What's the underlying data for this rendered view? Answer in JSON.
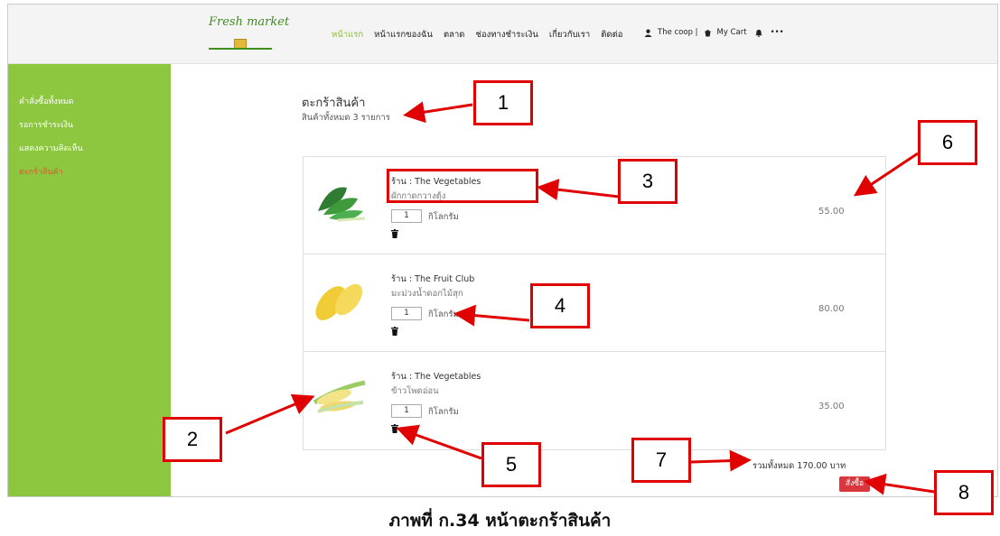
{
  "nav": {
    "logo": "Fresh market",
    "links": [
      "หน้าแรก",
      "หน้าแรกของฉัน",
      "ตลาด",
      "ช่องทางชำระเงิน",
      "เกี่ยวกับเรา",
      "ติดต่อ"
    ],
    "user": "The coop |",
    "cart": "My Cart",
    "more": "•••"
  },
  "sidebar": {
    "items": [
      "คำสั่งซื้อทั้งหมด",
      "รอการชำระเงิน",
      "แสดงความคิดเห็น",
      "ตะกร้าสินค้า"
    ],
    "active_index": 3
  },
  "cart": {
    "title": "ตะกร้าสินค้า",
    "subtitle": "สินค้าทั้งหมด 3 รายการ",
    "items": [
      {
        "shop": "ร้าน : The Vegetables",
        "name": "ผักกาดกวางตุ้ง",
        "qty": "1",
        "unit": "กิโลกรัม",
        "price": "55.00",
        "image": "leafy-greens"
      },
      {
        "shop": "ร้าน : The Fruit Club",
        "name": "มะม่วงน้ำดอกไม้สุก",
        "qty": "1",
        "unit": "กิโลกรัม",
        "price": "80.00",
        "image": "mango"
      },
      {
        "shop": "ร้าน : The Vegetables",
        "name": "ข้าวโพดอ่อน",
        "qty": "1",
        "unit": "กิโลกรัม",
        "price": "35.00",
        "image": "baby-corn"
      }
    ],
    "total": "รวมทั้งหมด 170.00 บาท",
    "order_button": "สั่งซื้อ"
  },
  "annotations": [
    "1",
    "2",
    "3",
    "4",
    "5",
    "6",
    "7",
    "8"
  ],
  "caption": "ภาพที่ ก.34 หน้าตะกร้าสินค้า",
  "colors": {
    "sidebar": "#8dc63f",
    "accent": "#e2562b",
    "order_button": "#d9363e",
    "annotation": "#e00000"
  }
}
